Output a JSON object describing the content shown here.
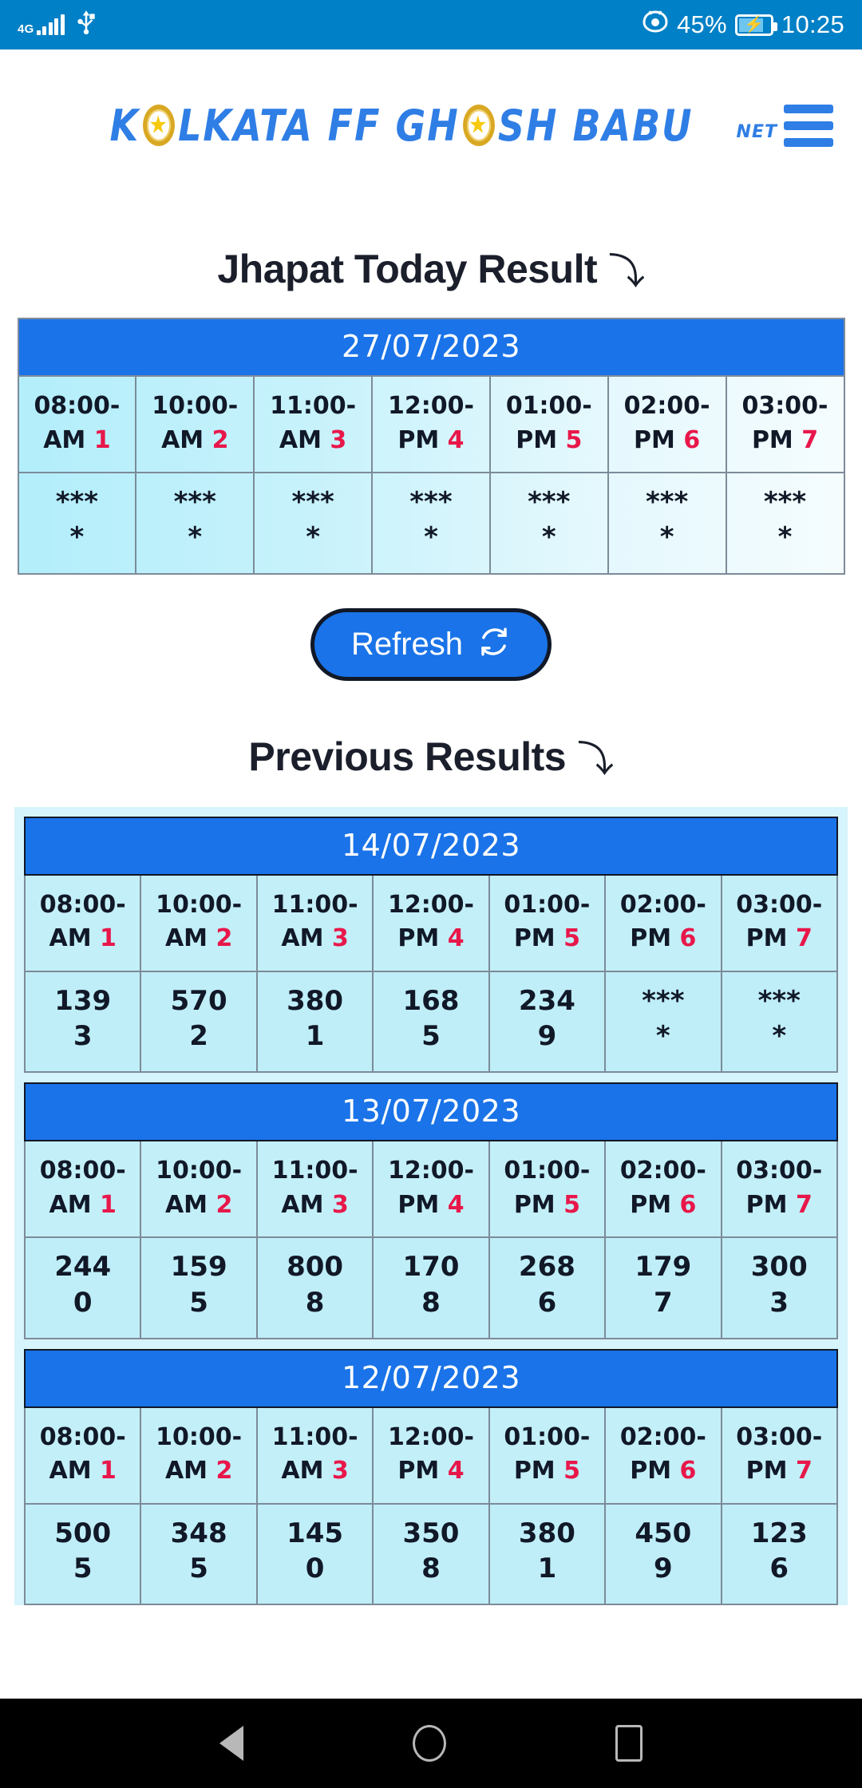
{
  "status_bar": {
    "network_type": "4G",
    "usb_icon": "usb-icon",
    "eye_icon": "eye-comfort-icon",
    "battery_percent": "45%",
    "battery_icon": "battery-charging-icon",
    "time": "10:25"
  },
  "header": {
    "logo_parts": [
      "K",
      "LKATA FF GH",
      "SH BABU"
    ],
    "logo_suffix": "NET",
    "menu_icon": "hamburger-menu-icon"
  },
  "today": {
    "title": "Jhapat Today Result",
    "arrow": "⤵",
    "date": "27/07/2023",
    "slots": [
      {
        "time": "08:00-AM",
        "index": "1",
        "value": "****"
      },
      {
        "time": "10:00-AM",
        "index": "2",
        "value": "****"
      },
      {
        "time": "11:00-AM",
        "index": "3",
        "value": "****"
      },
      {
        "time": "12:00-PM",
        "index": "4",
        "value": "****"
      },
      {
        "time": "01:00-PM",
        "index": "5",
        "value": "****"
      },
      {
        "time": "02:00-PM",
        "index": "6",
        "value": "****"
      },
      {
        "time": "03:00-PM",
        "index": "7",
        "value": "****"
      }
    ]
  },
  "refresh": {
    "label": "Refresh",
    "icon": "refresh-icon"
  },
  "previous": {
    "title": "Previous Results",
    "arrow": "⤵",
    "days": [
      {
        "date": "14/07/2023",
        "slots": [
          {
            "time": "08:00-AM",
            "index": "1",
            "value": "1393"
          },
          {
            "time": "10:00-AM",
            "index": "2",
            "value": "5702"
          },
          {
            "time": "11:00-AM",
            "index": "3",
            "value": "3801"
          },
          {
            "time": "12:00-PM",
            "index": "4",
            "value": "1685"
          },
          {
            "time": "01:00-PM",
            "index": "5",
            "value": "2349"
          },
          {
            "time": "02:00-PM",
            "index": "6",
            "value": "****"
          },
          {
            "time": "03:00-PM",
            "index": "7",
            "value": "****"
          }
        ]
      },
      {
        "date": "13/07/2023",
        "slots": [
          {
            "time": "08:00-AM",
            "index": "1",
            "value": "2440"
          },
          {
            "time": "10:00-AM",
            "index": "2",
            "value": "1595"
          },
          {
            "time": "11:00-AM",
            "index": "3",
            "value": "8008"
          },
          {
            "time": "12:00-PM",
            "index": "4",
            "value": "1708"
          },
          {
            "time": "01:00-PM",
            "index": "5",
            "value": "2686"
          },
          {
            "time": "02:00-PM",
            "index": "6",
            "value": "1797"
          },
          {
            "time": "03:00-PM",
            "index": "7",
            "value": "3003"
          }
        ]
      },
      {
        "date": "12/07/2023",
        "slots": [
          {
            "time": "08:00-AM",
            "index": "1",
            "value": "5005"
          },
          {
            "time": "10:00-AM",
            "index": "2",
            "value": "3485"
          },
          {
            "time": "11:00-AM",
            "index": "3",
            "value": "1450"
          },
          {
            "time": "12:00-PM",
            "index": "4",
            "value": "3508"
          },
          {
            "time": "01:00-PM",
            "index": "5",
            "value": "3801"
          },
          {
            "time": "02:00-PM",
            "index": "6",
            "value": "4509"
          },
          {
            "time": "03:00-PM",
            "index": "7",
            "value": "1236"
          }
        ]
      }
    ]
  },
  "nav_bar": {
    "back": "back-icon",
    "home": "home-icon",
    "recents": "recents-icon"
  },
  "colors": {
    "status_bar": "#0080c6",
    "brand_blue": "#2f7ee5",
    "header_blue": "#1a73e8",
    "accent_red": "#e8174a",
    "cell_cyan": "#bfeef8",
    "panel_cyan": "#d6f4fb"
  }
}
